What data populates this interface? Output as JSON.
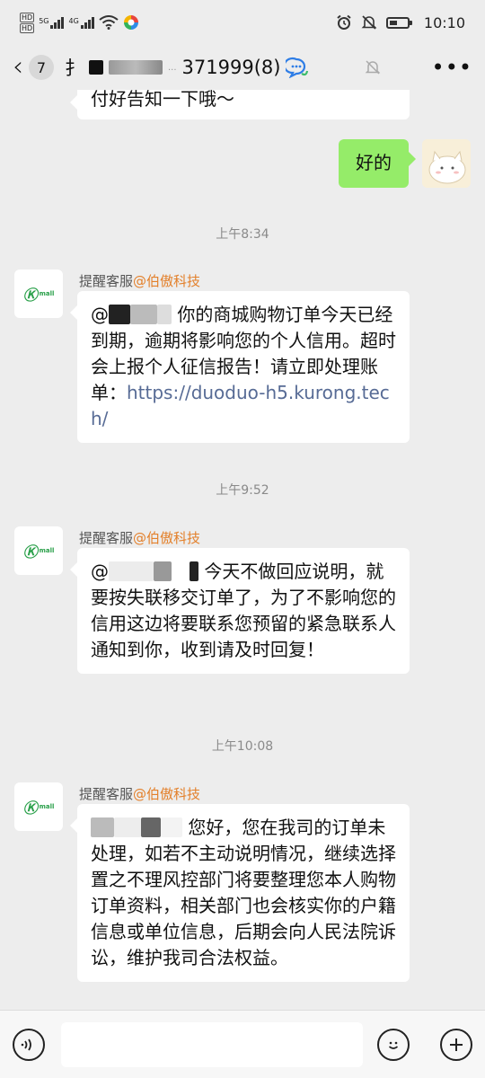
{
  "status_bar": {
    "hd1": "HD",
    "hd2": "HD",
    "net1": "5G",
    "net2": "4G",
    "time": "10:10"
  },
  "header": {
    "back_count": "7",
    "title_prefix": "扌",
    "title_mid": "...",
    "title_suffix": "371999(8)",
    "icon_names": [
      "back-arrow",
      "chat-bubble-icon",
      "mute-bell-icon",
      "more-icon"
    ]
  },
  "messages": [
    {
      "type": "incoming_partial",
      "text": "付好告知一下哦～"
    },
    {
      "type": "outgoing",
      "text": "好的"
    },
    {
      "type": "time",
      "text": "上午8:34"
    },
    {
      "type": "incoming",
      "sender": "提醒客服",
      "org": "@伯傲科技",
      "parts": {
        "a": "@",
        "b": "你的商城购物订单今天已经到期，逾期将影响您的个人信用。超时会上报个人征信报告！请立即处理账单：",
        "link": "https://duoduo-h5.kurong.tech/"
      }
    },
    {
      "type": "time",
      "text": "上午9:52"
    },
    {
      "type": "incoming",
      "sender": "提醒客服",
      "org": "@伯傲科技",
      "parts": {
        "a": "@",
        "b": "今天不做回应说明，就要按失联移交订单了，为了不影响您的信用这边将要联系您预留的紧急联系人通知到你，收到请及时回复！"
      }
    },
    {
      "type": "time",
      "text": "上午10:08"
    },
    {
      "type": "incoming",
      "sender": "提醒客服",
      "org": "@伯傲科技",
      "parts": {
        "b": "您好，您在我司的订单未处理，如若不主动说明情况，继续选择置之不理风控部门将要整理您本人购物订单资料，相关部门也会核实你的户籍信息或单位信息，后期会向人民法院诉讼，维护我司合法权益。"
      }
    }
  ],
  "avatar_logo": {
    "mark": "Ⓚ",
    "text": "mall"
  },
  "input_bar": {
    "value": ""
  },
  "colors": {
    "outgoing_bubble": "#95ec69",
    "org_name": "#e3802b",
    "link": "#576b95",
    "background": "#ededed"
  }
}
